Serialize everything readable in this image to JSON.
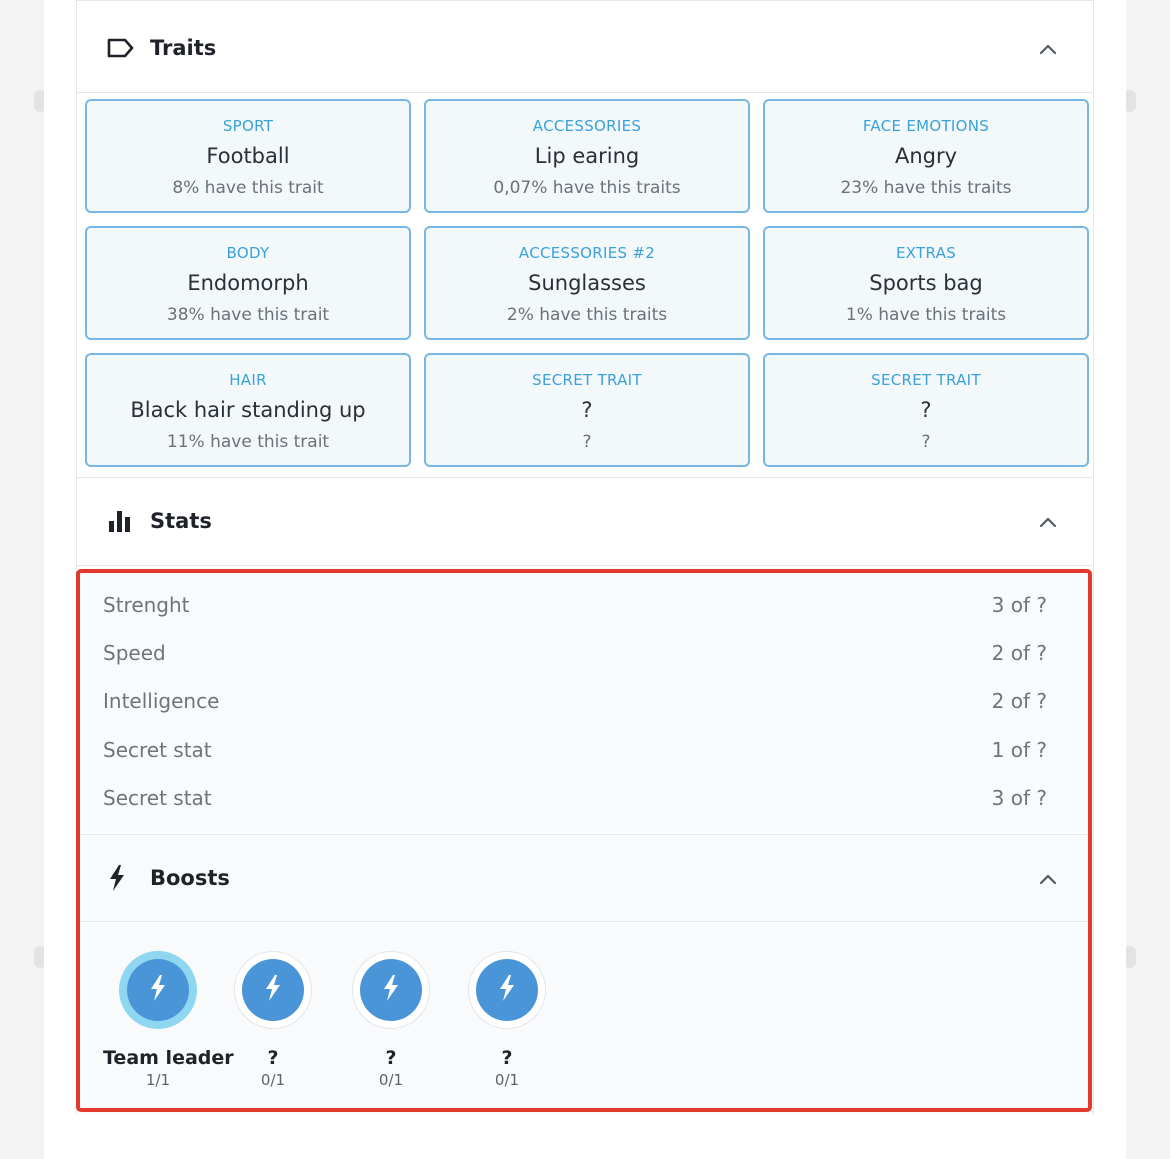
{
  "traits_section": {
    "title": "Traits",
    "items": [
      {
        "type": "SPORT",
        "value": "Football",
        "rarity": "8% have this trait"
      },
      {
        "type": "ACCESSORIES",
        "value": "Lip earing",
        "rarity": "0,07% have this traits"
      },
      {
        "type": "FACE EMOTIONS",
        "value": "Angry",
        "rarity": "23% have this traits"
      },
      {
        "type": "BODY",
        "value": "Endomorph",
        "rarity": "38% have this trait"
      },
      {
        "type": "ACCESSORIES #2",
        "value": "Sunglasses",
        "rarity": "2% have this traits"
      },
      {
        "type": "EXTRAS",
        "value": "Sports bag",
        "rarity": "1% have this traits"
      },
      {
        "type": "HAIR",
        "value": "Black hair standing up",
        "rarity": "11% have this trait"
      },
      {
        "type": "SECRET TRAIT",
        "value": "?",
        "rarity": "?"
      },
      {
        "type": "SECRET TRAIT",
        "value": "?",
        "rarity": "?"
      }
    ]
  },
  "stats_section": {
    "title": "Stats",
    "items": [
      {
        "name": "Strenght",
        "value": "3 of ?"
      },
      {
        "name": "Speed",
        "value": "2 of ?"
      },
      {
        "name": "Intelligence",
        "value": "2 of ?"
      },
      {
        "name": "Secret stat",
        "value": "1 of ?"
      },
      {
        "name": "Secret stat",
        "value": "3 of ?"
      }
    ]
  },
  "boosts_section": {
    "title": "Boosts",
    "items": [
      {
        "name": "Team leader",
        "count": "1/1"
      },
      {
        "name": "?",
        "count": "0/1"
      },
      {
        "name": "?",
        "count": "0/1"
      },
      {
        "name": "?",
        "count": "0/1"
      }
    ]
  },
  "colors": {
    "accent": "#3aa1d9",
    "trait_border": "#76b8e3",
    "boost_blue": "#4a95d8",
    "boost_active_glow": "#8fd6f1",
    "highlight_red": "#e23a2c"
  },
  "icons": {
    "traits": "tag-icon",
    "stats": "bar-chart-icon",
    "boosts": "lightning-bolt-icon",
    "collapse": "chevron-up-icon"
  }
}
